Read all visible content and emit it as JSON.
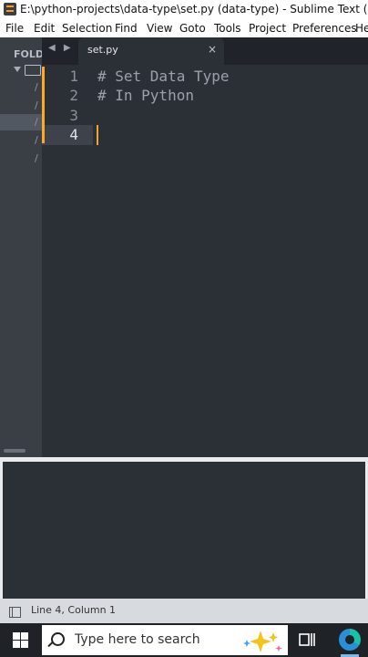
{
  "window": {
    "title": "E:\\python-projects\\data-type\\set.py (data-type) - Sublime Text (UNREGISTERED)"
  },
  "menu": [
    "File",
    "Edit",
    "Selection",
    "Find",
    "View",
    "Goto",
    "Tools",
    "Project",
    "Preferences",
    "Help"
  ],
  "sidebar": {
    "header": "FOLDERS",
    "items": [
      "/",
      "/",
      "/",
      "/",
      "/"
    ]
  },
  "tabs": [
    {
      "label": "set.py",
      "active": true,
      "close": "×"
    }
  ],
  "editor": {
    "lines": [
      {
        "number": "1",
        "text": "# Set Data Type"
      },
      {
        "number": "2",
        "text": "# In Python"
      },
      {
        "number": "3",
        "text": ""
      },
      {
        "number": "4",
        "text": ""
      }
    ],
    "active_line": "4"
  },
  "statusbar": {
    "position": "Line 4, Column 1"
  },
  "taskbar": {
    "search_placeholder": "Type here to search"
  },
  "icons": {
    "app": "sublime-text-icon",
    "nav": "tab-nav-arrows-icon",
    "search": "search-icon",
    "windows": "windows-logo-icon",
    "taskview": "task-view-icon",
    "browser": "edge-icon"
  },
  "colors": {
    "accent": "#ffa72a",
    "editor_bg": "#2b2f36",
    "comment": "#9ba1aa"
  }
}
